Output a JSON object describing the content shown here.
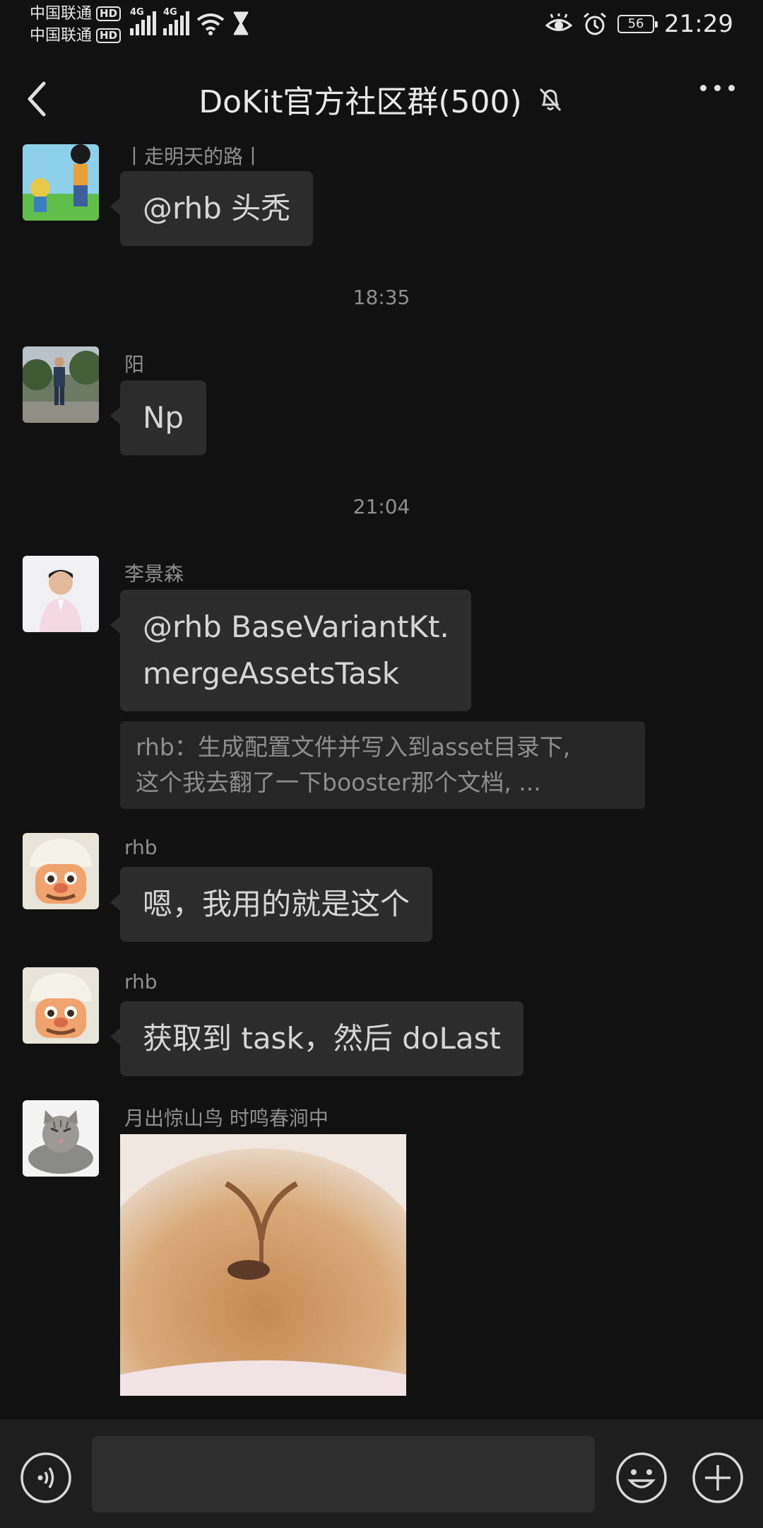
{
  "status_bar": {
    "carrier_1": "中国联通",
    "carrier_2": "中国联通",
    "hd_badge": "HD",
    "network_type": "4G",
    "battery_level": "56",
    "time": "21:29"
  },
  "header": {
    "title": "DoKit官方社区群(500)"
  },
  "messages": [
    {
      "type": "text",
      "sender": "丨走明天的路丨",
      "text": "@rhb  头秃",
      "avatar": "one-piece-avatar"
    },
    {
      "type": "time",
      "text": "18:35"
    },
    {
      "type": "text",
      "sender": "阳",
      "text": "Np",
      "avatar": "man-standing-avatar"
    },
    {
      "type": "time",
      "text": "21:04"
    },
    {
      "type": "text",
      "sender": "李景森",
      "text_line1": "@rhb  BaseVariantKt.",
      "text_line2": "mergeAssetsTask",
      "avatar": "man-shirt-avatar",
      "quote_line1": "rhb：生成配置文件并写入到asset目录下,",
      "quote_line2": "这个我去翻了一下booster那个文档, ..."
    },
    {
      "type": "text",
      "sender": "rhb",
      "text": "嗯，我用的就是这个",
      "avatar": "cartoon-chef-avatar"
    },
    {
      "type": "text",
      "sender": "rhb",
      "text": "获取到 task，然后 doLast",
      "avatar": "cartoon-chef-avatar"
    },
    {
      "type": "image",
      "sender": "月出惊山鸟  时鸣春涧中",
      "image": "bunny-nose-photo",
      "avatar": "cat-avatar"
    }
  ],
  "colors": {
    "background": "#111111",
    "bubble": "#2c2c2c",
    "text_muted": "#8f8f8f",
    "input_bar": "#1e1e1e"
  }
}
